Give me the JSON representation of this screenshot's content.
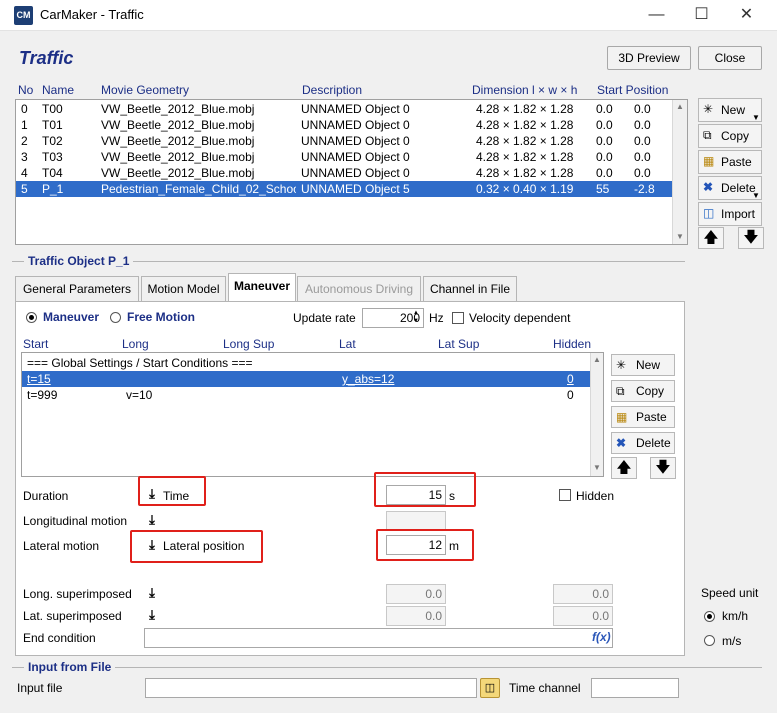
{
  "window": {
    "app_icon_text": "CM",
    "title": "CarMaker - Traffic",
    "minimize_icon": "minimize-icon",
    "maximize_icon": "maximize-icon",
    "close_icon": "close-icon"
  },
  "header": {
    "title": "Traffic",
    "preview_label": "3D Preview",
    "close_label": "Close"
  },
  "traffic_table": {
    "columns": [
      "No",
      "Name",
      "Movie Geometry",
      "Description",
      "Dimension l × w × h",
      "Start Position"
    ],
    "rows": [
      {
        "no": "0",
        "name": "T00",
        "geometry": "VW_Beetle_2012_Blue.mobj",
        "description": "UNNAMED Object 0",
        "dimension": "4.28 × 1.82 × 1.28",
        "start_a": "0.0",
        "start_b": "0.0"
      },
      {
        "no": "1",
        "name": "T01",
        "geometry": "VW_Beetle_2012_Blue.mobj",
        "description": "UNNAMED Object 0",
        "dimension": "4.28 × 1.82 × 1.28",
        "start_a": "0.0",
        "start_b": "0.0"
      },
      {
        "no": "2",
        "name": "T02",
        "geometry": "VW_Beetle_2012_Blue.mobj",
        "description": "UNNAMED Object 0",
        "dimension": "4.28 × 1.82 × 1.28",
        "start_a": "0.0",
        "start_b": "0.0"
      },
      {
        "no": "3",
        "name": "T03",
        "geometry": "VW_Beetle_2012_Blue.mobj",
        "description": "UNNAMED Object 0",
        "dimension": "4.28 × 1.82 × 1.28",
        "start_a": "0.0",
        "start_b": "0.0"
      },
      {
        "no": "4",
        "name": "T04",
        "geometry": "VW_Beetle_2012_Blue.mobj",
        "description": "UNNAMED Object 0",
        "dimension": "4.28 × 1.82 × 1.28",
        "start_a": "0.0",
        "start_b": "0.0"
      },
      {
        "no": "5",
        "name": "P_1",
        "geometry": "Pedestrian_Female_Child_02_SchoolBag.mobj",
        "description": "UNNAMED Object 5",
        "dimension": "0.32 × 0.40 × 1.19",
        "start_a": "55",
        "start_b": "-2.8"
      }
    ],
    "selected_index": 5
  },
  "side_buttons": {
    "new": "New",
    "copy": "Copy",
    "paste": "Paste",
    "delete": "Delete",
    "import": "Import"
  },
  "traffic_object": {
    "title": "Traffic Object P_1",
    "tabs": [
      "General Parameters",
      "Motion Model",
      "Maneuver",
      "Autonomous Driving",
      "Channel in File"
    ],
    "active_tab": "Maneuver"
  },
  "maneuver": {
    "mode_maneuver": "Maneuver",
    "mode_free_motion": "Free Motion",
    "update_rate_label": "Update rate",
    "update_rate_value": "200",
    "update_rate_unit": "Hz",
    "velocity_dependent_label": "Velocity dependent",
    "columns": [
      "Start",
      "Long",
      "Long Sup",
      "Lat",
      "Lat Sup",
      "Hidden"
    ],
    "rows": [
      {
        "start": "=== Global Settings / Start Conditions ===",
        "long": "",
        "lat": "",
        "hidden": ""
      },
      {
        "start": "t=15",
        "long": "",
        "lat": "y_abs=12",
        "hidden": "0"
      },
      {
        "start": "t=999",
        "long": "v=10",
        "lat": "",
        "hidden": "0"
      }
    ],
    "buttons": {
      "new": "New",
      "copy": "Copy",
      "paste": "Paste",
      "delete": "Delete"
    }
  },
  "fields": {
    "duration_label": "Duration",
    "duration_type": "Time",
    "duration_value": "15",
    "duration_unit": "s",
    "hidden_label": "Hidden",
    "longitudinal_label": "Longitudinal motion",
    "lateral_label": "Lateral motion",
    "lateral_type": "Lateral position",
    "lateral_value": "12",
    "lateral_unit": "m",
    "long_superimposed_label": "Long. superimposed",
    "long_superimposed_a": "0.0",
    "long_superimposed_b": "0.0",
    "lat_superimposed_label": "Lat. superimposed",
    "lat_superimposed_a": "0.0",
    "lat_superimposed_b": "0.0",
    "end_condition_label": "End condition",
    "fx_label": "f(x)"
  },
  "speed_unit": {
    "label": "Speed unit",
    "kmh": "km/h",
    "ms": "m/s",
    "selected": "km/h"
  },
  "input_from_file": {
    "title": "Input from File",
    "input_file_label": "Input file",
    "time_channel_label": "Time channel"
  },
  "colors": {
    "accent": "#1c2f86",
    "selection": "#2f6cc9",
    "highlight_box": "#e0201a"
  }
}
